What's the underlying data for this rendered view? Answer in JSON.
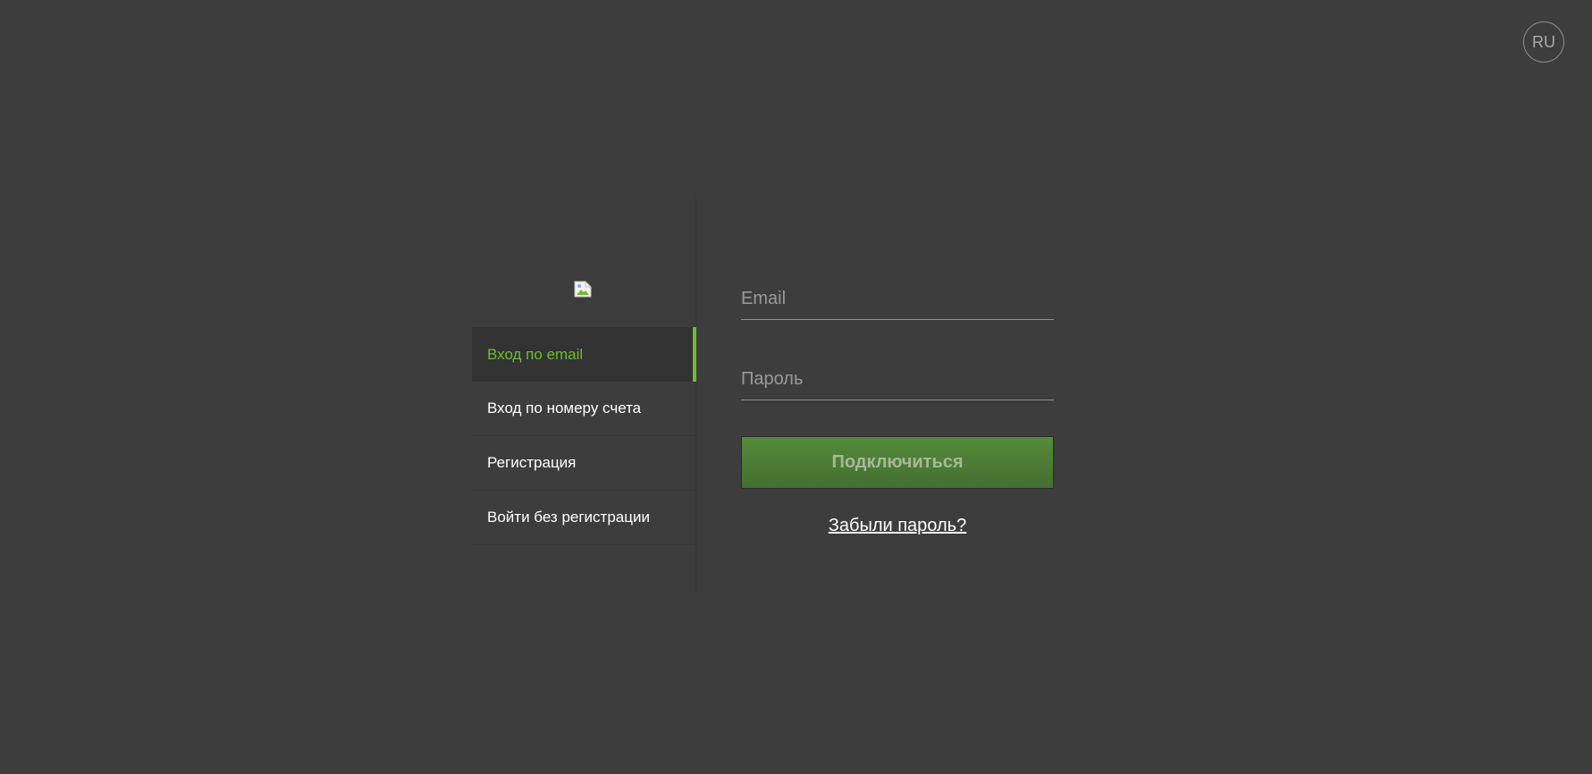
{
  "header": {
    "language": "RU"
  },
  "sidebar": {
    "logo_icon": "broken-image-icon",
    "items": [
      {
        "label": "Вход по email",
        "active": true
      },
      {
        "label": "Вход по номеру счета",
        "active": false
      },
      {
        "label": "Регистрация",
        "active": false
      },
      {
        "label": "Войти без регистрации",
        "active": false
      }
    ]
  },
  "form": {
    "email_placeholder": "Email",
    "password_placeholder": "Пароль",
    "submit_label": "Подключиться",
    "forgot_label": "Забыли пароль?"
  },
  "colors": {
    "background": "#3d3d3d",
    "accent": "#6fbe2c",
    "button": "#4f7f36"
  }
}
